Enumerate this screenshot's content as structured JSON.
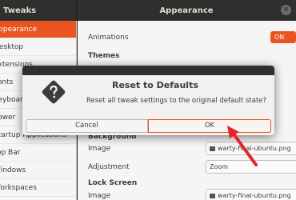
{
  "titlebar": {
    "app_title": "Tweaks",
    "panel_title": "Appearance",
    "close_glyph": "×"
  },
  "sidebar": {
    "items": [
      {
        "label": "Appearance"
      },
      {
        "label": "Desktop"
      },
      {
        "label": "Extensions"
      },
      {
        "label": "Fonts"
      },
      {
        "label": "Keyboard & Mouse"
      },
      {
        "label": "Power"
      },
      {
        "label": "Startup Applications"
      },
      {
        "label": "Top Bar"
      },
      {
        "label": "Windows"
      },
      {
        "label": "Workspaces"
      }
    ]
  },
  "content": {
    "animations_label": "Animations",
    "animations_value": "ON",
    "themes_header": "Themes",
    "background_header": "Background",
    "background_image_label": "Image",
    "background_image_value": "warty-final-ubuntu.png",
    "adjustment_label": "Adjustment",
    "adjustment_value": "Zoom",
    "lockscreen_header": "Lock Screen",
    "lock_image_label": "Image",
    "lock_image_value": "warty-final-ubuntu.png"
  },
  "dialog": {
    "title": "Reset to Defaults",
    "message": "Reset all tweak settings to the original default state?",
    "cancel_label": "Cancel",
    "ok_label": "OK"
  },
  "colors": {
    "accent": "#e95420",
    "arrow": "#e3242b"
  }
}
